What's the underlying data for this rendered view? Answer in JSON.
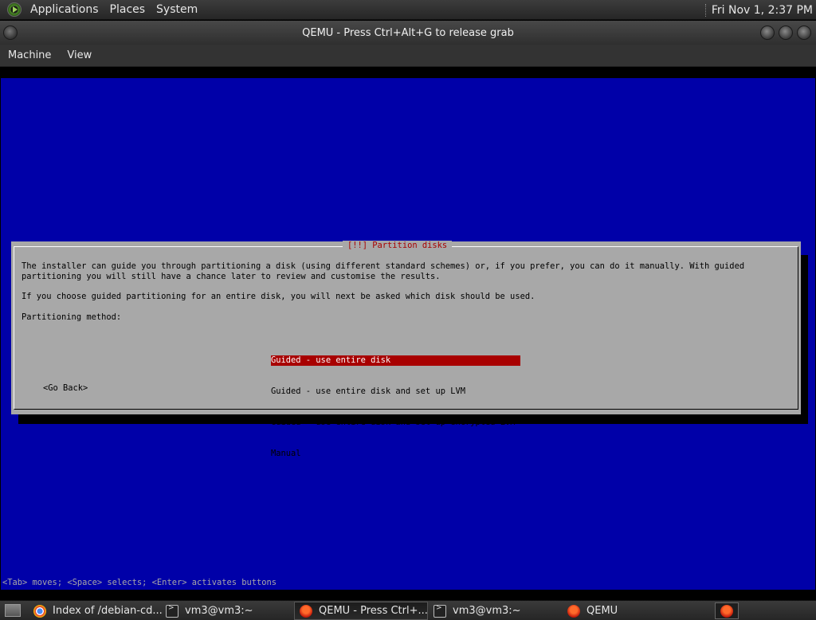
{
  "top_panel": {
    "menus": [
      "Applications",
      "Places",
      "System"
    ],
    "clock": "Fri Nov 1, 2:37 PM"
  },
  "window": {
    "title": "QEMU - Press Ctrl+Alt+G to release grab",
    "menus": [
      "Machine",
      "View"
    ]
  },
  "installer": {
    "dialog_title": "[!!] Partition disks",
    "text_lines": [
      "The installer can guide you through partitioning a disk (using different standard schemes) or, if you prefer, you can do it manually. With guided",
      "partitioning you will still have a chance later to review and customise the results.",
      "If you choose guided partitioning for an entire disk, you will next be asked which disk should be used.",
      "Partitioning method:"
    ],
    "options": [
      "Guided - use entire disk",
      "Guided - use entire disk and set up LVM",
      "Guided - use entire disk and set up encrypted LVM",
      "Manual"
    ],
    "selected_index": 0,
    "go_back": "<Go Back>",
    "status_line": "<Tab> moves; <Space> selects; <Enter> activates buttons"
  },
  "taskbar": {
    "tasks": [
      {
        "label": "Index of /debian-cd...",
        "icon": "chrome-icon"
      },
      {
        "label": "vm3@vm3:~",
        "icon": "terminal-icon"
      },
      {
        "label": "QEMU - Press Ctrl+...",
        "icon": "qemu-icon",
        "active": true
      },
      {
        "label": "vm3@vm3:~",
        "icon": "terminal-icon"
      },
      {
        "label": "QEMU",
        "icon": "qemu-icon"
      }
    ]
  },
  "colors": {
    "qemu_background": "#0000a8",
    "dialog_background": "#a8a8a8",
    "selection": "#a80000",
    "title_text": "#a80000"
  }
}
